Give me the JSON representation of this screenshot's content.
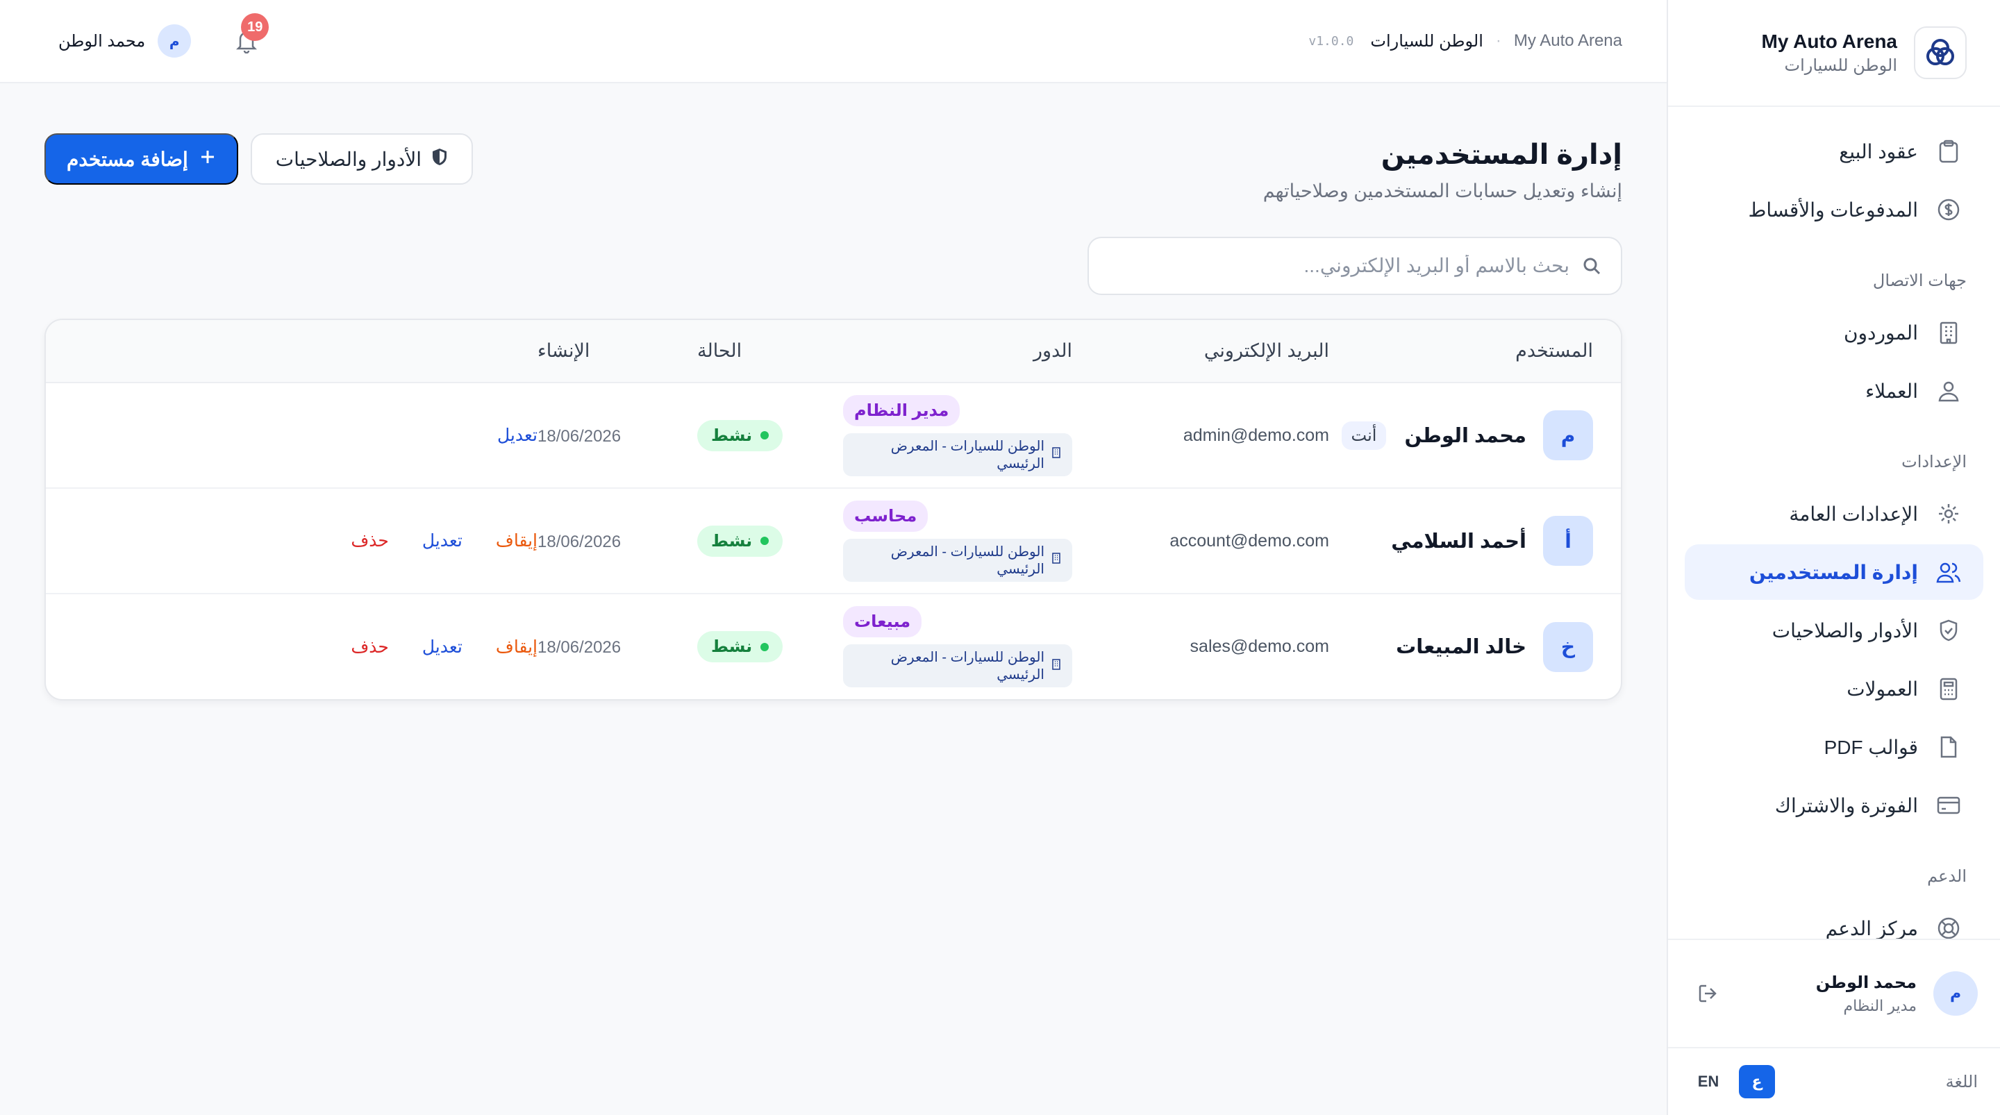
{
  "brand": {
    "title": "My Auto Arena",
    "subtitle": "الوطن للسيارات"
  },
  "sidebar": {
    "items_top": [
      {
        "label": "عقود البيع",
        "icon": "clipboard-icon"
      },
      {
        "label": "المدفوعات والأقساط",
        "icon": "dollar-icon"
      }
    ],
    "section_contacts": "جهات الاتصال",
    "items_contacts": [
      {
        "label": "الموردون",
        "icon": "building-icon"
      },
      {
        "label": "العملاء",
        "icon": "user-icon"
      }
    ],
    "section_settings": "الإعدادات",
    "items_settings": [
      {
        "label": "الإعدادات العامة",
        "icon": "gear-icon"
      },
      {
        "label": "إدارة المستخدمين",
        "icon": "users-icon",
        "active": true
      },
      {
        "label": "الأدوار والصلاحيات",
        "icon": "shield-icon"
      },
      {
        "label": "العمولات",
        "icon": "calculator-icon"
      },
      {
        "label": "قوالب PDF",
        "icon": "file-icon"
      },
      {
        "label": "الفوترة والاشتراك",
        "icon": "credit-card-icon"
      }
    ],
    "section_support": "الدعم",
    "items_support": [
      {
        "label": "مركز الدعم",
        "icon": "lifebuoy-icon"
      }
    ],
    "user": {
      "initial": "م",
      "name": "محمد الوطن",
      "role": "مدير النظام"
    },
    "language": {
      "label": "اللغة",
      "ar": "ع",
      "en": "EN"
    }
  },
  "topbar": {
    "crumb_home": "My Auto Arena",
    "crumb_sep": "·",
    "crumb_current": "الوطن للسيارات",
    "version": "v1.0.0",
    "notifications_count": "19",
    "user_initial": "م",
    "user_name": "محمد الوطن"
  },
  "page": {
    "title": "إدارة المستخدمين",
    "subtitle": "إنشاء وتعديل حسابات المستخدمين وصلاحياتهم",
    "roles_button": "الأدوار والصلاحيات",
    "add_button": "إضافة مستخدم",
    "search_placeholder": "بحث بالاسم أو البريد الإلكتروني..."
  },
  "table": {
    "headers": {
      "user": "المستخدم",
      "email": "البريد الإلكتروني",
      "role": "الدور",
      "status": "الحالة",
      "created": "الإنشاء"
    },
    "rows": [
      {
        "initial": "م",
        "name": "محمد الوطن",
        "you": "أنت",
        "email": "admin@demo.com",
        "role": "مدير النظام",
        "branch": "الوطن للسيارات - المعرض الرئيسي",
        "status": "نشط",
        "created": "18/06/2026",
        "actions": {
          "edit": "تعديل"
        }
      },
      {
        "initial": "أ",
        "name": "أحمد السلامي",
        "email": "account@demo.com",
        "role": "محاسب",
        "branch": "الوطن للسيارات - المعرض الرئيسي",
        "status": "نشط",
        "created": "18/06/2026",
        "actions": {
          "suspend": "إيقاف",
          "edit": "تعديل",
          "delete": "حذف"
        }
      },
      {
        "initial": "خ",
        "name": "خالد المبيعات",
        "email": "sales@demo.com",
        "role": "مبيعات",
        "branch": "الوطن للسيارات - المعرض الرئيسي",
        "status": "نشط",
        "created": "18/06/2026",
        "actions": {
          "suspend": "إيقاف",
          "edit": "تعديل",
          "delete": "حذف"
        }
      }
    ]
  },
  "colors": {
    "primary": "#1565e8",
    "active_nav_bg": "#eef3ff",
    "status_green_bg": "#dcfce7",
    "role_purple_bg": "#f3e8ff",
    "badge_red": "#ef6b6b"
  }
}
